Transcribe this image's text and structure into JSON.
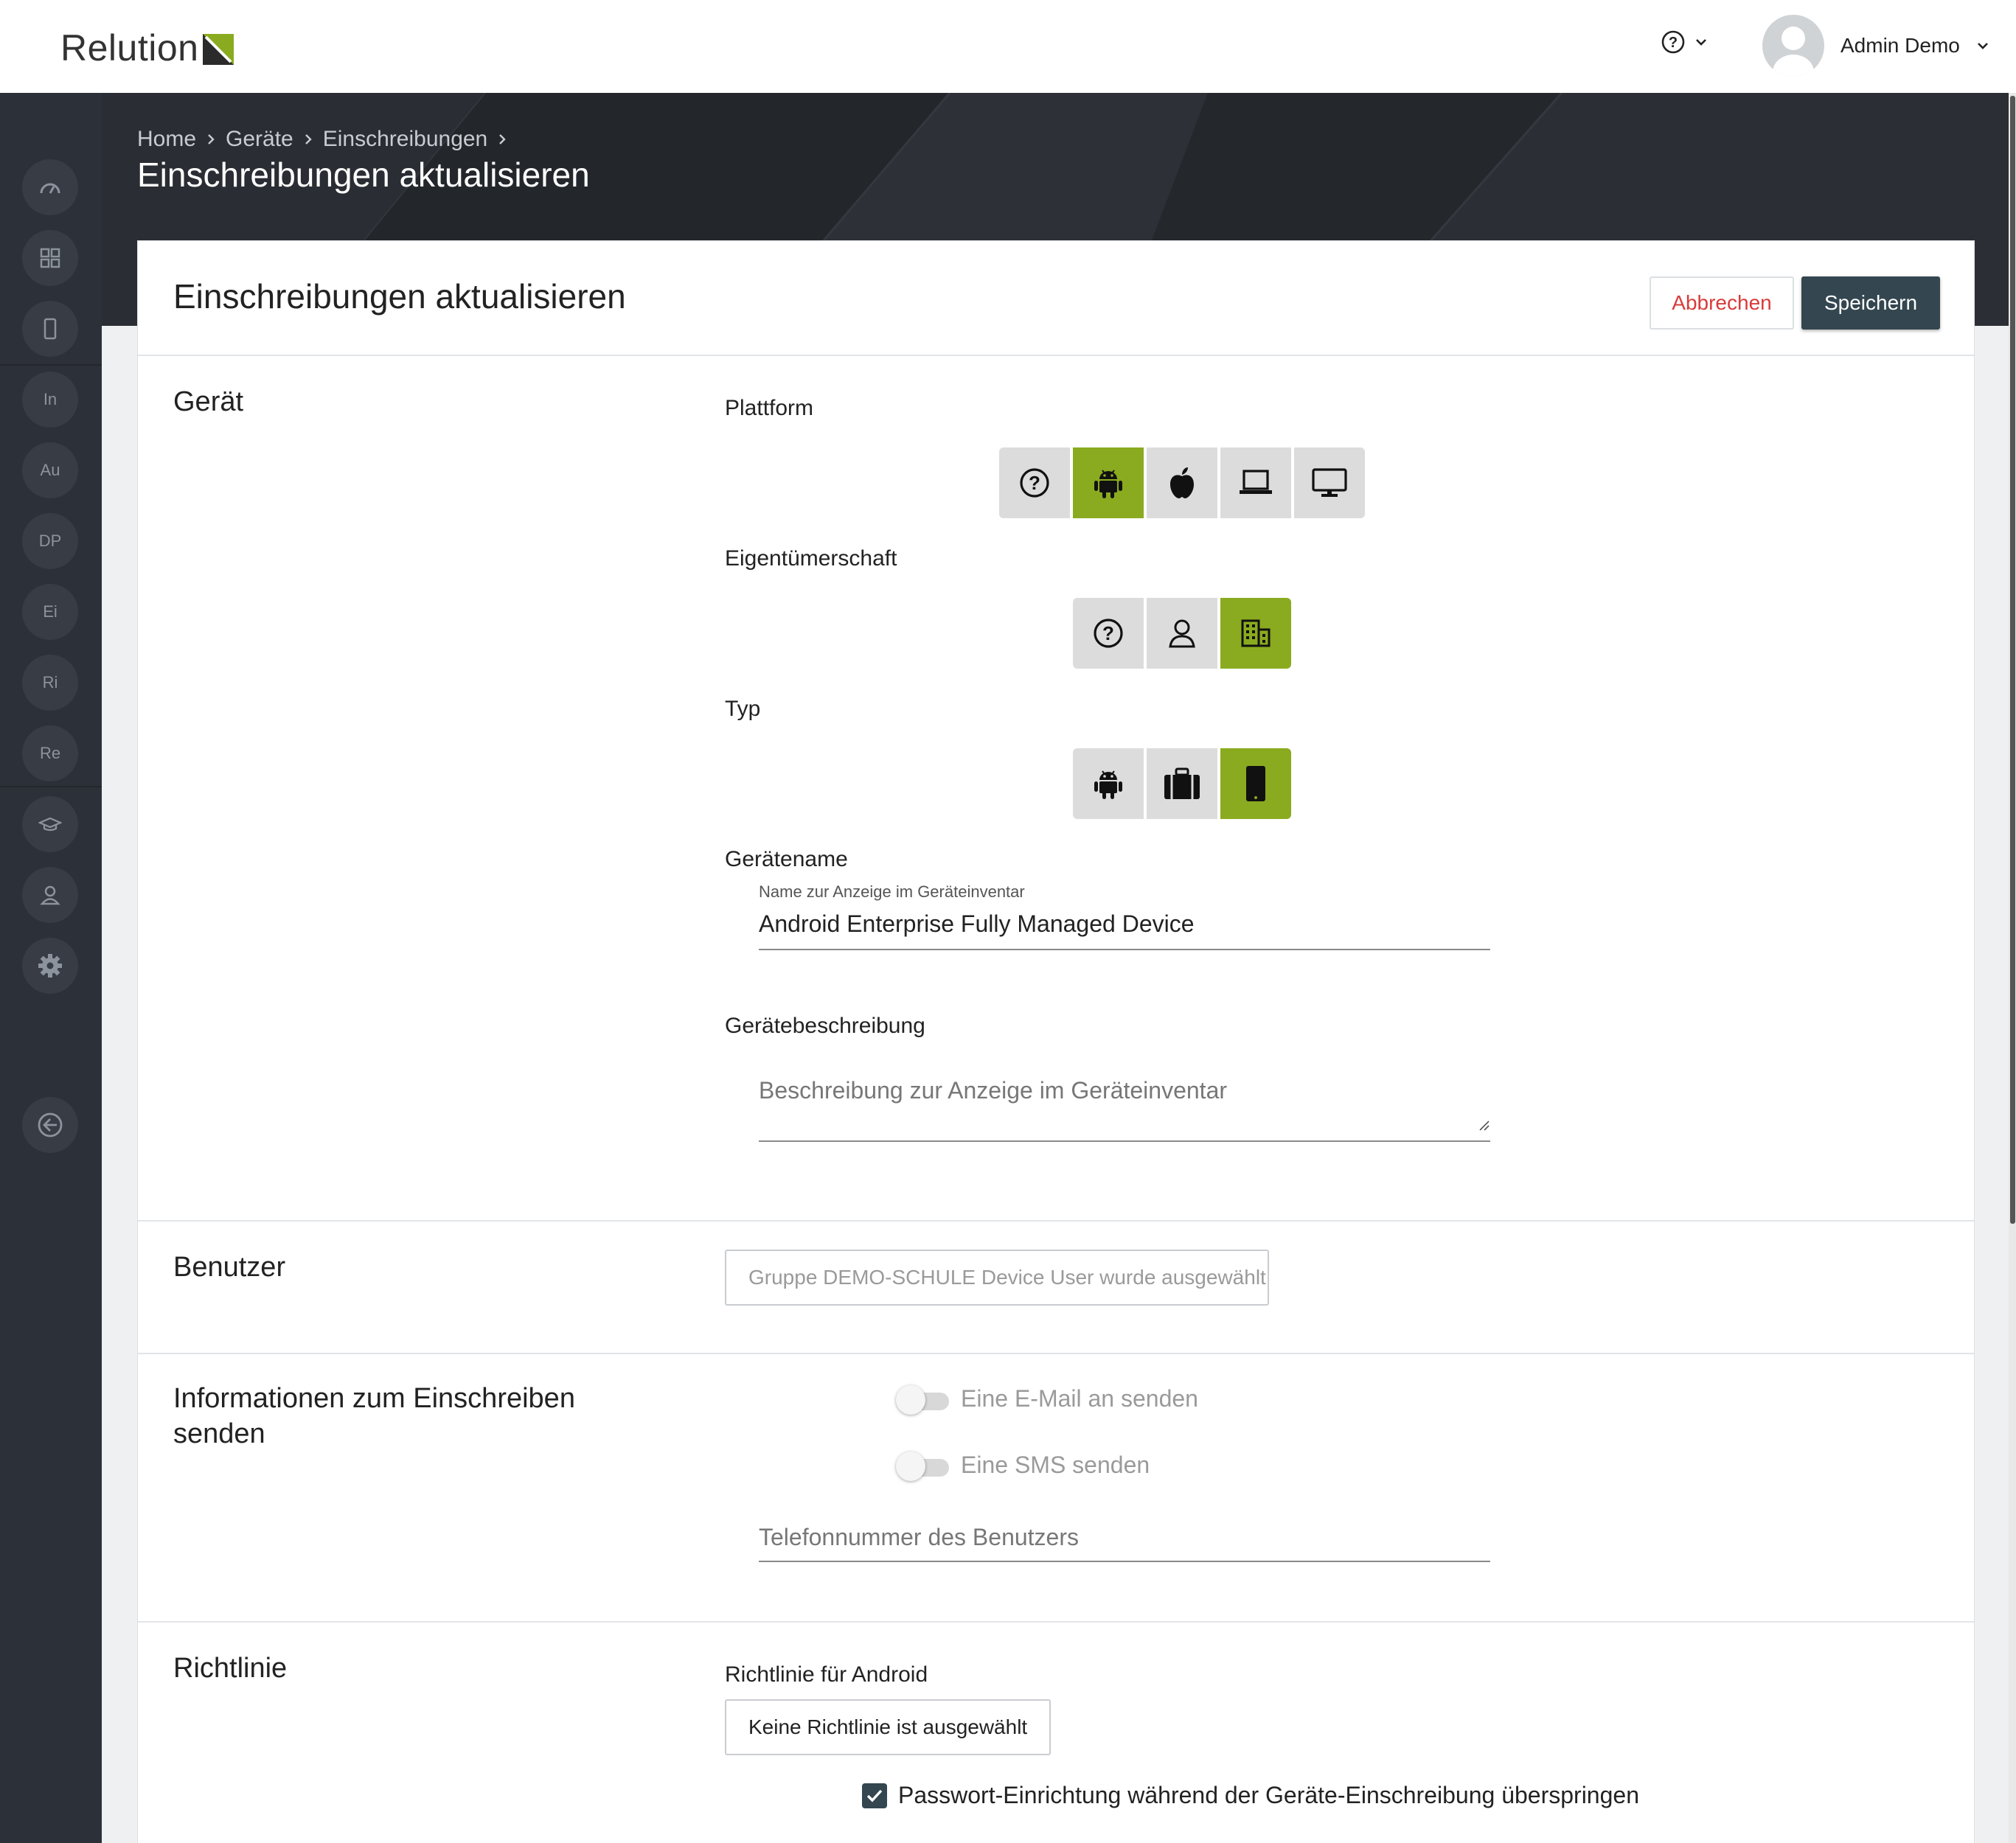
{
  "app": {
    "logo_text": "Relution",
    "brand_color": "#8aab1f"
  },
  "header": {
    "help_icon": "help-circle-icon",
    "user_name": "Admin Demo"
  },
  "sidebar": {
    "items": [
      {
        "icon": "dashboard-icon"
      },
      {
        "icon": "apps-grid-icon"
      },
      {
        "icon": "device-icon"
      },
      {
        "label": "In"
      },
      {
        "label": "Au"
      },
      {
        "label": "DP"
      },
      {
        "label": "Ei"
      },
      {
        "label": "Ri"
      },
      {
        "label": "Re"
      },
      {
        "icon": "graduation-cap-icon"
      },
      {
        "icon": "user-icon"
      },
      {
        "icon": "settings-gear-icon"
      },
      {
        "icon": "back-arrow-icon"
      }
    ]
  },
  "breadcrumb": [
    "Home",
    "Geräte",
    "Einschreibungen"
  ],
  "page": {
    "hero_title": "Einschreibungen aktualisieren"
  },
  "card": {
    "title": "Einschreibungen aktualisieren",
    "cancel_label": "Abbrechen",
    "save_label": "Speichern"
  },
  "device": {
    "section_title": "Gerät",
    "platform": {
      "label": "Plattform",
      "options": [
        "unknown",
        "android",
        "ios",
        "macos",
        "windows"
      ],
      "selected": "android"
    },
    "ownership": {
      "label": "Eigentümerschaft",
      "options": [
        "unknown",
        "personal",
        "company"
      ],
      "selected": "company"
    },
    "type": {
      "label": "Typ",
      "options": [
        "android",
        "work-profile",
        "fully-managed"
      ],
      "selected": "fully-managed"
    },
    "name": {
      "label": "Gerätename",
      "hint": "Name zur Anzeige im Geräteinventar",
      "value": "Android Enterprise Fully Managed Device"
    },
    "description": {
      "label": "Gerätebeschreibung",
      "placeholder": "Beschreibung zur Anzeige im Geräteinventar"
    }
  },
  "user": {
    "section_title": "Benutzer",
    "selection_placeholder": "Gruppe DEMO-SCHULE Device User wurde ausgewählt"
  },
  "enroll_info": {
    "section_title": "Informationen zum Einschreiben senden",
    "email_toggle": "Eine E-Mail an senden",
    "sms_toggle": "Eine SMS senden",
    "phone_placeholder": "Telefonnummer des Benutzers"
  },
  "policy": {
    "section_title": "Richtlinie",
    "android_label": "Richtlinie für Android",
    "android_value": "Keine Richtlinie ist ausgewählt",
    "skip_password_label": "Passwort-Einrichtung während der Geräte-Einschreibung überspringen",
    "skip_password_checked": true
  }
}
